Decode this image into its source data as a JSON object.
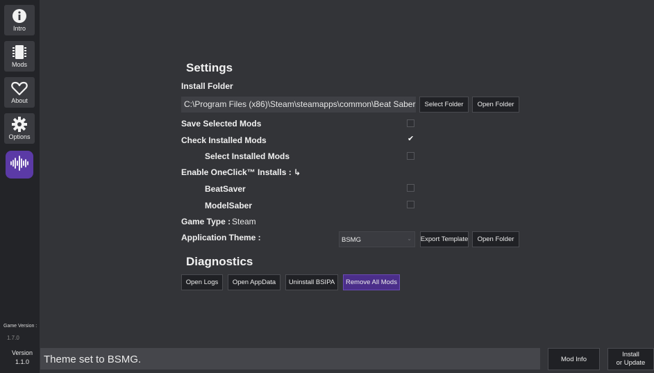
{
  "sidebar": {
    "items": [
      {
        "label": "Intro",
        "icon": "info-icon"
      },
      {
        "label": "Mods",
        "icon": "chip-icon"
      },
      {
        "label": "About",
        "icon": "heart-icon"
      },
      {
        "label": "Options",
        "icon": "gear-icon"
      }
    ],
    "theme_icon": "soundwave-icon",
    "theme_color": "#5b3aa6",
    "game_version_label": "Game Version :",
    "game_version_value": "1.7.0",
    "version_label": "Version",
    "version_value": "1.1.0"
  },
  "settings": {
    "title": "Settings",
    "install_folder_label": "Install Folder",
    "install_folder_path": "C:\\Program Files (x86)\\Steam\\steamapps\\common\\Beat Saber",
    "select_folder": "Select Folder",
    "open_folder": "Open Folder",
    "save_selected_mods": {
      "label": "Save Selected Mods",
      "checked": false
    },
    "check_installed_mods": {
      "label": "Check Installed Mods",
      "checked": true
    },
    "select_installed_mods": {
      "label": "Select Installed Mods",
      "checked": false
    },
    "oneclick_label": "Enable OneClick™ Installs : ↳",
    "beatsaver": {
      "label": "BeatSaver",
      "checked": false
    },
    "modelsaber": {
      "label": "ModelSaber",
      "checked": false
    },
    "game_type_label": "Game Type :",
    "game_type_value": "Steam",
    "app_theme_label": "Application Theme :",
    "app_theme_value": "BSMG",
    "export_template": "Export Template",
    "open_folder_2": "Open Folder"
  },
  "diagnostics": {
    "title": "Diagnostics",
    "buttons": [
      "Open Logs",
      "Open AppData",
      "Uninstall BSIPA",
      "Remove All Mods"
    ],
    "accent": "#4b2e8a"
  },
  "status_bar": {
    "message": "Theme set to BSMG.",
    "mod_info": "Mod Info",
    "install_line1": "Install",
    "install_line2": "or Update"
  }
}
